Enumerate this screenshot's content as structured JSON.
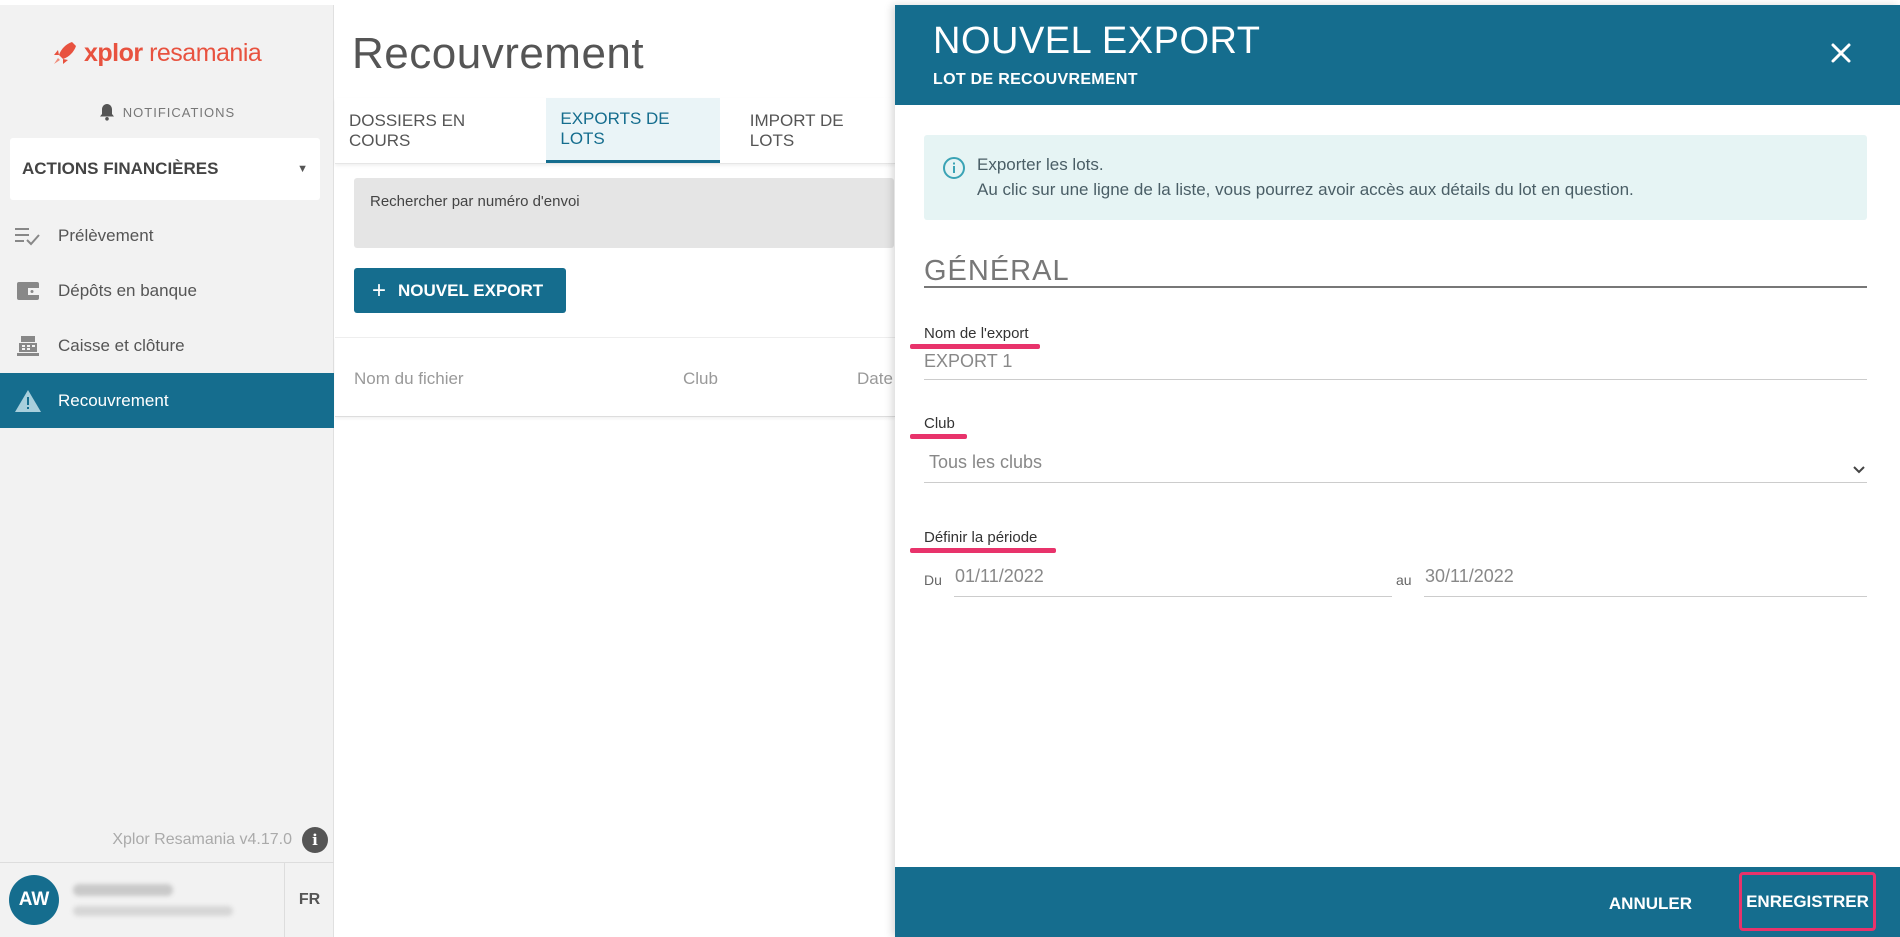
{
  "brand": {
    "name_bold": "xplor",
    "name_light": " resamania"
  },
  "sidebar": {
    "notifications": "NOTIFICATIONS",
    "section": "ACTIONS FINANCIÈRES",
    "items": [
      {
        "label": "Prélèvement",
        "icon": "list-check-icon",
        "active": false
      },
      {
        "label": "Dépôts en banque",
        "icon": "wallet-icon",
        "active": false
      },
      {
        "label": "Caisse et clôture",
        "icon": "cash-register-icon",
        "active": false
      },
      {
        "label": "Recouvrement",
        "icon": "warning-icon",
        "active": true
      }
    ],
    "version": "Xplor Resamania v4.17.0",
    "user_initials": "AW",
    "language": "FR"
  },
  "main": {
    "title": "Recouvrement",
    "tabs": [
      {
        "label": "DOSSIERS EN COURS",
        "active": false
      },
      {
        "label": "EXPORTS DE LOTS",
        "active": true
      },
      {
        "label": "IMPORT DE LOTS",
        "active": false
      }
    ],
    "search_placeholder": "Rechercher par numéro d'envoi",
    "new_export_button": "NOUVEL EXPORT",
    "columns": [
      "Nom du fichier",
      "Club",
      "Date"
    ]
  },
  "drawer": {
    "title": "NOUVEL EXPORT",
    "subtitle": "LOT DE RECOUVREMENT",
    "info_line1": "Exporter les lots.",
    "info_line2": "Au clic sur une ligne de la liste, vous pourrez avoir accès aux détails du lot en question.",
    "section_title": "GÉNÉRAL",
    "export_name_label": "Nom de l'export",
    "export_name_value": "EXPORT 1",
    "club_label": "Club",
    "club_value": "Tous les clubs",
    "period_label": "Définir la période",
    "from_label": "Du",
    "from_value": "01/11/2022",
    "to_label": "au",
    "to_value": "30/11/2022",
    "cancel_button": "ANNULER",
    "save_button": "ENREGISTRER"
  },
  "colors": {
    "primary": "#156d8e",
    "highlight": "#e8336b",
    "brand": "#e8523f"
  }
}
